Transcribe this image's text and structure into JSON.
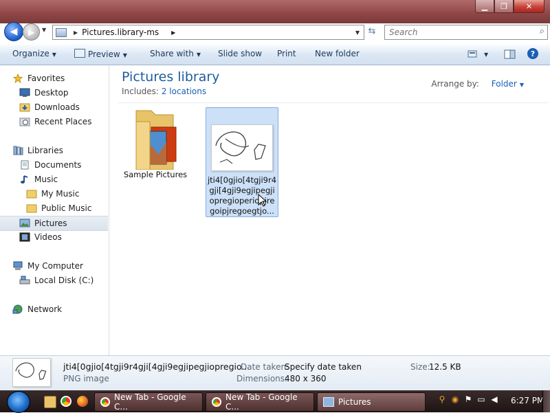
{
  "address": {
    "path": "Pictures.library-ms"
  },
  "search": {
    "placeholder": "Search"
  },
  "toolbar": {
    "organize": "Organize",
    "preview": "Preview",
    "share_with": "Share with",
    "slide_show": "Slide show",
    "print": "Print",
    "new_folder": "New folder"
  },
  "sidebar": {
    "favorites": "Favorites",
    "desktop": "Desktop",
    "downloads": "Downloads",
    "recent_places": "Recent Places",
    "libraries": "Libraries",
    "documents": "Documents",
    "music": "Music",
    "my_music": "My Music",
    "public_music": "Public Music",
    "pictures": "Pictures",
    "videos": "Videos",
    "my_computer": "My Computer",
    "local_disk": "Local Disk (C:)",
    "network": "Network"
  },
  "main": {
    "title": "Pictures library",
    "includes_label": "Includes:",
    "includes_link": "2 locations",
    "arrange_by_label": "Arrange by:",
    "arrange_by_value": "Folder",
    "items": [
      {
        "label": "Sample Pictures"
      },
      {
        "label_lines": [
          "jti4[0gjio[4tgji9r4",
          "gji[4gji9egjipegji",
          "opregioperiopjre",
          "goipjregoegtjo..."
        ]
      }
    ]
  },
  "details": {
    "filename": "jti4[0gjio[4tgji9r4gji[4gji9egjipegjiopregio...",
    "filetype": "PNG image",
    "date_taken_label": "Date taken:",
    "date_taken_value": "Specify date taken",
    "dimensions_label": "Dimensions:",
    "dimensions_value": "480 x 360",
    "size_label": "Size:",
    "size_value": "12.5 KB"
  },
  "taskbar": {
    "buttons": [
      "New Tab - Google C...",
      "New Tab - Google C...",
      "Pictures"
    ],
    "clock": "6:27 PM"
  }
}
